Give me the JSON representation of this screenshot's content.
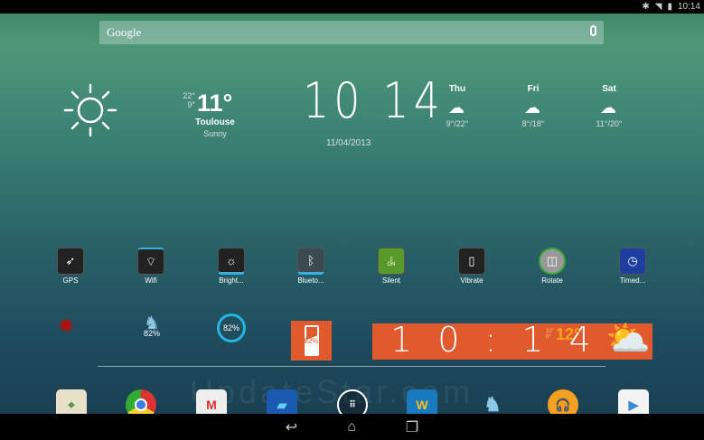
{
  "status": {
    "time": "10:14"
  },
  "search": {
    "label": "Google"
  },
  "weather": {
    "high": "22°",
    "low": "9°",
    "current": "11°",
    "city": "Toulouse",
    "condition": "Sunny"
  },
  "clock": {
    "time": "10 14",
    "date": "11/04/2013"
  },
  "forecast": [
    {
      "day": "Thu",
      "temps": "9°/22°"
    },
    {
      "day": "Fri",
      "temps": "8°/18°"
    },
    {
      "day": "Sat",
      "temps": "11°/20°"
    }
  ],
  "toggles": [
    {
      "label": "GPS"
    },
    {
      "label": "Wifi"
    },
    {
      "label": "Bright..."
    },
    {
      "label": "Blueto..."
    },
    {
      "label": "Silent",
      "state": "ON"
    },
    {
      "label": "Vibrate"
    },
    {
      "label": "Rotate"
    },
    {
      "label": "Timed..."
    }
  ],
  "battery": {
    "bird": "82%",
    "ring": "82%",
    "tile": "82%"
  },
  "orange_clock": {
    "time": "1 0 : 1 4",
    "temp": "12°",
    "high": "22°",
    "low": "9°"
  },
  "watermark": "UpdateStar.com",
  "colors": {
    "orange": "#e05a2e",
    "temp": "#f4a21b"
  }
}
